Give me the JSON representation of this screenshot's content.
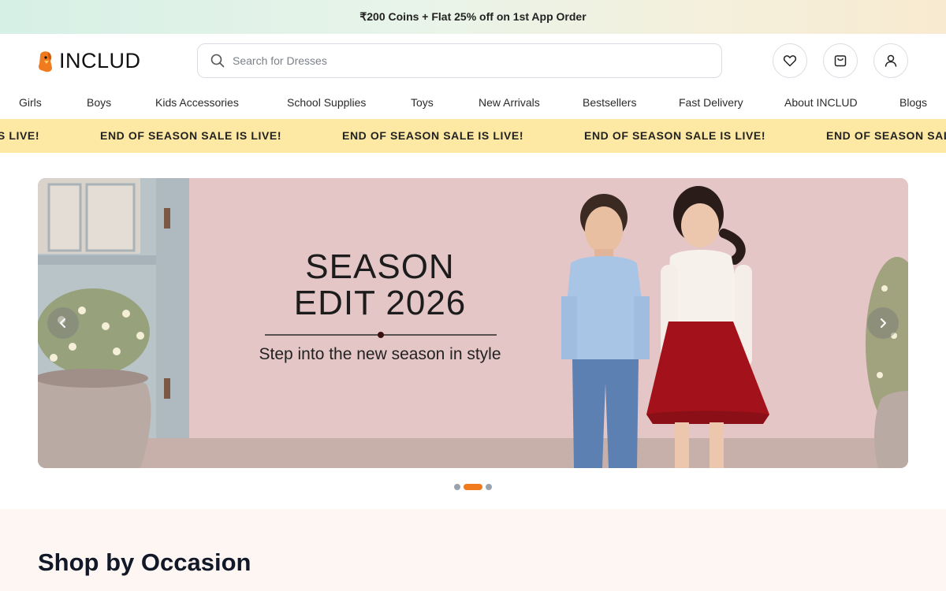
{
  "promo": {
    "text": "₹200 Coins + Flat 25% off on 1st App Order"
  },
  "header": {
    "logo_text": "INCLUD",
    "search_placeholder": "Search for Dresses",
    "icons": [
      "heart-icon",
      "bag-icon",
      "user-icon"
    ]
  },
  "nav": {
    "items": [
      {
        "label": "Girls"
      },
      {
        "label": "Boys"
      },
      {
        "label": "Kids Accessories"
      },
      {
        "label": "School Supplies"
      },
      {
        "label": "Toys"
      },
      {
        "label": "New Arrivals"
      },
      {
        "label": "Bestsellers"
      },
      {
        "label": "Fast Delivery"
      },
      {
        "label": "About INCLUD"
      },
      {
        "label": "Blogs"
      }
    ]
  },
  "ticker": {
    "items": [
      "END OF SEASON SALE IS LIVE!",
      "END OF SEASON SALE IS LIVE!",
      "END OF SEASON SALE IS LIVE!",
      "END OF SEASON SALE IS LIVE!",
      "END OF SEASON SALE IS LIVE!"
    ]
  },
  "banner": {
    "title_line1": "SEASON",
    "title_line2": "EDIT 2026",
    "subtitle": "Step into the new season in style",
    "slide_count": 3,
    "active_slide": 2
  },
  "occasion": {
    "title": "Shop by Occasion"
  },
  "colors": {
    "accent": "#f07a1e",
    "ticker_bg": "#fde9a3",
    "banner_bg": "#e3c3c3"
  }
}
